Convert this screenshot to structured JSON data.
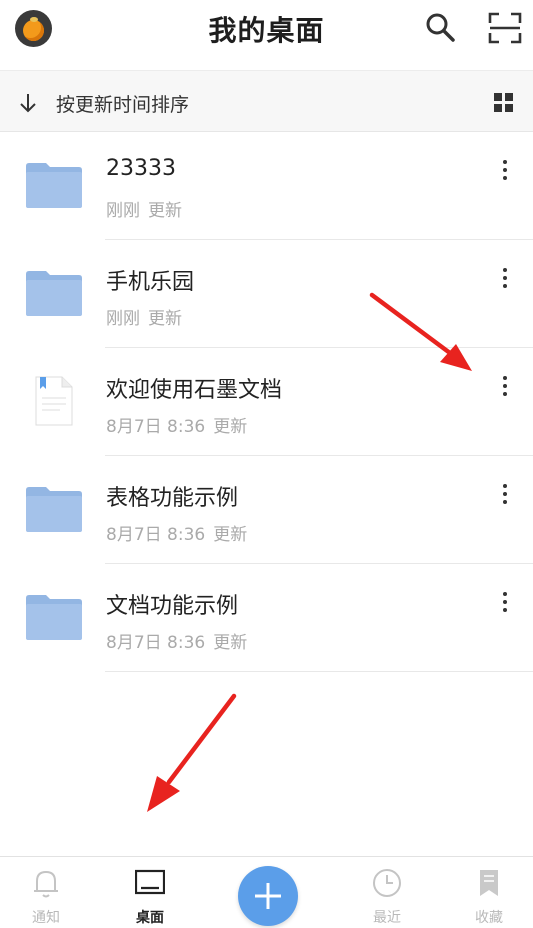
{
  "header": {
    "title": "我的桌面",
    "avatar_icon": "orange-avatar",
    "search_icon": "search-icon",
    "scan_icon": "scan-icon"
  },
  "sortbar": {
    "label": "按更新时间排序",
    "sort_icon": "arrow-down-icon",
    "view_icon": "grid-view-icon"
  },
  "files": [
    {
      "name": "23333",
      "time": "刚刚",
      "suffix": "更新",
      "type": "folder"
    },
    {
      "name": "手机乐园",
      "time": "刚刚",
      "suffix": "更新",
      "type": "folder"
    },
    {
      "name": "欢迎使用石墨文档",
      "time": "8月7日 8:36",
      "suffix": "更新",
      "type": "document"
    },
    {
      "name": "表格功能示例",
      "time": "8月7日 8:36",
      "suffix": "更新",
      "type": "folder"
    },
    {
      "name": "文档功能示例",
      "time": "8月7日 8:36",
      "suffix": "更新",
      "type": "folder"
    }
  ],
  "tabbar": {
    "notify": "通知",
    "desktop": "桌面",
    "recent": "最近",
    "favorites": "收藏",
    "add_icon": "plus-icon"
  },
  "colors": {
    "folder": "#93b6e3",
    "accent": "#5b9ee9",
    "annotation_arrow": "#e8231f"
  }
}
